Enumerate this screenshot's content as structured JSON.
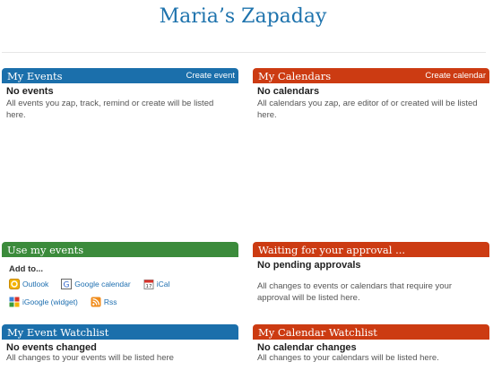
{
  "page": {
    "title": "Maria’s Zapaday"
  },
  "my_events": {
    "title": "My Events",
    "action": "Create event",
    "empty_title": "No events",
    "description": "All events you zap, track, remind or create will be listed here."
  },
  "my_calendars": {
    "title": "My Calendars",
    "action": "Create calendar",
    "empty_title": "No calendars",
    "description": "All calendars you zap, are editor of or created will be listed here."
  },
  "use_events": {
    "title": "Use my events",
    "add_to": "Add to...",
    "links": [
      {
        "label": "Outlook",
        "icon": "outlook-icon"
      },
      {
        "label": "Google calendar",
        "icon": "google-calendar-icon"
      },
      {
        "label": "iCal",
        "icon": "ical-icon"
      },
      {
        "label": "iGoogle (widget)",
        "icon": "igoogle-icon"
      },
      {
        "label": "Rss",
        "icon": "rss-icon"
      }
    ]
  },
  "approval": {
    "title": "Waiting for your approval ...",
    "empty_title": "No pending approvals",
    "description": "All changes to events or calendars that require your approval will be listed here."
  },
  "event_watchlist": {
    "title": "My Event Watchlist",
    "empty_title": "No events changed",
    "description": "All changes to your events will be listed here"
  },
  "calendar_watchlist": {
    "title": "My Calendar Watchlist",
    "empty_title": "No calendar changes",
    "description": "All changes to your calendars will be listed here."
  },
  "colors": {
    "blue": "#1b6fab",
    "red": "#cc3b12",
    "green": "#3b8b3b",
    "title": "#1e73ad"
  }
}
